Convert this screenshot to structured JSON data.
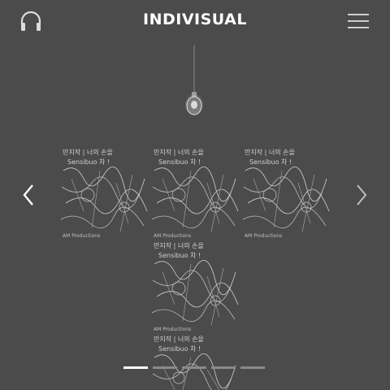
{
  "header": {
    "title": "INDIVISUAL",
    "headphone_icon": "headphones-icon",
    "menu_icon": "hamburger-menu-icon"
  },
  "carousel": {
    "prev_icon": "chevron-left-icon",
    "next_icon": "chevron-right-icon",
    "slide_count": 5,
    "active_index": 0
  },
  "artwork": {
    "lamp_icon": "hanging-light-bulb-icon",
    "tile_texts": [
      "만지작 | 너의 손을",
      "Sensibuo 차 !",
      "AM Productions"
    ]
  },
  "colors": {
    "background": "#4b4b4b",
    "title": "#ffffff",
    "dot_active": "#ffffff",
    "dot_inactive": "#8a8a8a"
  }
}
